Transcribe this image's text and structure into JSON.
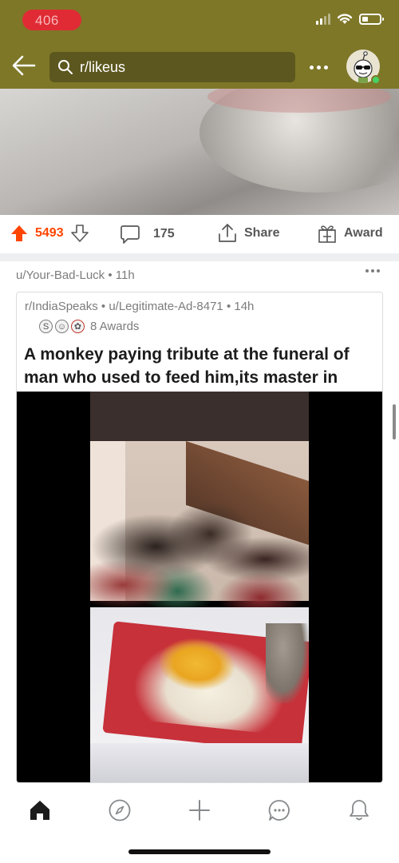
{
  "status_bar": {
    "recording_indicator": "406"
  },
  "header": {
    "search_text": "r/likeus",
    "colors": {
      "bar": "#7e7728",
      "search_bg": "#5c571e"
    }
  },
  "previous_post_actions": {
    "score": "5493",
    "comments": "175",
    "share_label": "Share",
    "award_label": "Award",
    "upvote_color": "#ff4500"
  },
  "post": {
    "author": "u/Your-Bad-Luck",
    "age": "11h",
    "crosspost": {
      "subreddit": "r/IndiaSpeaks",
      "author": "u/Legitimate-Ad-8471",
      "age": "14h",
      "awards_label": "8 Awards",
      "title": "A monkey paying tribute at the funeral of man who used to feed him,its master in Batticaloa."
    }
  },
  "bottom_nav": {
    "items": [
      "home-icon",
      "discover-icon",
      "create-post-icon",
      "chat-icon",
      "notifications-icon"
    ]
  }
}
